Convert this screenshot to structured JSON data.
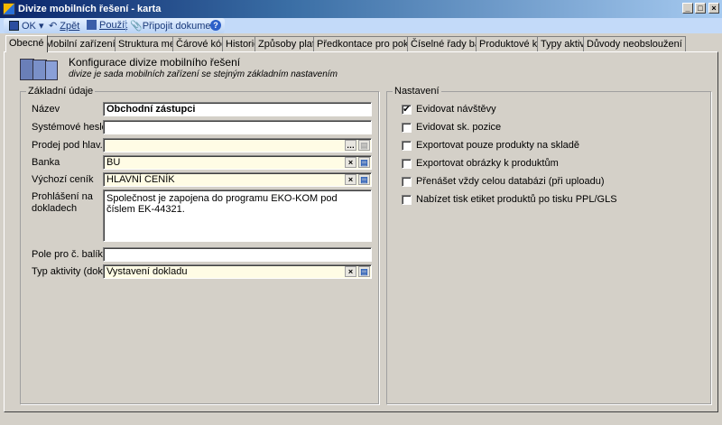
{
  "window": {
    "title": "Divize mobilních řešení - karta",
    "minimize": "_",
    "maximize": "□",
    "close": "×"
  },
  "toolbar": {
    "ok": "OK",
    "back": "Zpět",
    "apply": "Použít",
    "attach": "Připojit dokument",
    "help": "?"
  },
  "tabs": [
    "Obecné",
    "Mobilní zařízení PDA",
    "Struktura menu",
    "Čárové kódy",
    "Historie",
    "Způsoby plateb",
    "Předkontace pro pokladnu",
    "Číselné řady balíků",
    "Produktové klíče",
    "Typy aktivit",
    "Důvody neobsloužení"
  ],
  "header": {
    "title": "Konfigurace divize mobilního řešení",
    "subtitle": "divize je sada mobilních zařízení se stejným základním nastavením"
  },
  "basic": {
    "legend": "Základní údaje",
    "fields": [
      {
        "label": "Název",
        "value": "Obchodní zástupci"
      },
      {
        "label": "Systémové heslo",
        "value": ""
      },
      {
        "label": "Prodej pod hlav.",
        "value": ""
      },
      {
        "label": "Banka",
        "value": "BU"
      },
      {
        "label": "Výchozí ceník",
        "value": "HLAVNÍ CENÍK"
      },
      {
        "label": "Prohlášení na dokladech",
        "value": "Společnost je zapojena do programu EKO-KOM pod číslem EK-44321."
      },
      {
        "label": "Pole pro č. balíků",
        "value": ""
      },
      {
        "label": "Typ aktivity (dokl.)",
        "value": "Vystavení dokladu"
      }
    ]
  },
  "settings": {
    "legend": "Nastavení",
    "items": [
      {
        "label": "Evidovat návštěvy",
        "checked": true
      },
      {
        "label": "Evidovat sk. pozice",
        "checked": false
      },
      {
        "label": "Exportovat pouze produkty na skladě",
        "checked": false
      },
      {
        "label": "Exportovat obrázky k produktům",
        "checked": false
      },
      {
        "label": "Přenášet vždy celou databázi (při uploadu)",
        "checked": false
      },
      {
        "label": "Nabízet tisk etiket produktů po tisku PPL/GLS",
        "checked": false
      }
    ]
  }
}
